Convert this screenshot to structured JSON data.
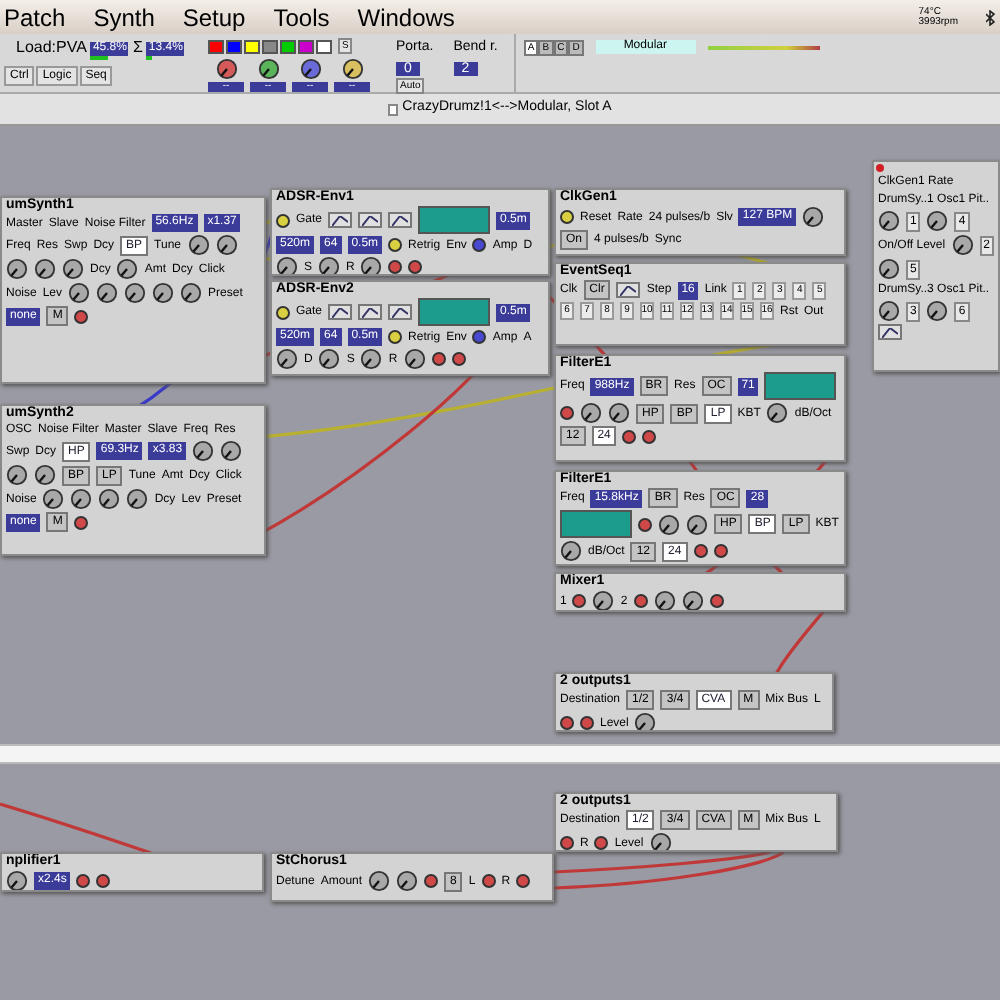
{
  "menu": [
    {
      "label": "Patch"
    },
    {
      "label": "Synth"
    },
    {
      "label": "Setup"
    },
    {
      "label": "Tools"
    },
    {
      "label": "Windows"
    }
  ],
  "status": {
    "temperature": "74°C",
    "fan": "3993rpm"
  },
  "load": {
    "label": "Load:PVA",
    "pva": {
      "value": "45.8%",
      "level": 0.45
    },
    "sigma": "Σ",
    "total": {
      "value": "13.4%",
      "level": 0.13
    }
  },
  "view_tabs": [
    {
      "label": "Ctrl"
    },
    {
      "label": "Logic"
    },
    {
      "label": "Seq"
    }
  ],
  "colors": [
    {
      "color": "#ff0000"
    },
    {
      "color": "#0000ff"
    },
    {
      "color": "#ffff00"
    },
    {
      "color": "#888888"
    },
    {
      "color": "#00cc00"
    },
    {
      "color": "#cc00cc"
    },
    {
      "color": "#ffffff"
    }
  ],
  "color_key": "S",
  "morph_knobs": [
    {
      "color": "#d45a5a",
      "value": "--"
    },
    {
      "color": "#5ab55a",
      "value": "--"
    },
    {
      "color": "#6a6ad8",
      "value": "--"
    },
    {
      "color": "#d8c060",
      "value": "--"
    }
  ],
  "porta": {
    "label": "Porta.",
    "value": "0",
    "auto": "Auto"
  },
  "bend": {
    "label": "Bend r.",
    "value": "2"
  },
  "slots": [
    {
      "label": "A",
      "selected": true
    },
    {
      "label": "B",
      "selected": false
    },
    {
      "label": "C",
      "selected": false
    },
    {
      "label": "D",
      "selected": false
    }
  ],
  "patch_name": "Modular",
  "title": "CrazyDrumz!1<-->Modular, Slot A",
  "modules": [
    {
      "title": "umSynth1",
      "items": [
        {
          "kind": "label",
          "text": "Master"
        },
        {
          "kind": "label",
          "text": "Slave"
        },
        {
          "kind": "label",
          "text": "Noise Filter"
        },
        {
          "kind": "display",
          "text": "56.6Hz"
        },
        {
          "kind": "display",
          "text": "x1.37"
        },
        {
          "kind": "label",
          "text": "Freq"
        },
        {
          "kind": "label",
          "text": "Res"
        },
        {
          "kind": "label",
          "text": "Swp"
        },
        {
          "kind": "label",
          "text": "Dcy"
        },
        {
          "kind": "button",
          "text": "BP",
          "selected": true
        },
        {
          "kind": "label",
          "text": "Tune"
        },
        {
          "kind": "knob"
        },
        {
          "kind": "knob"
        },
        {
          "kind": "knob"
        },
        {
          "kind": "knob"
        },
        {
          "kind": "knob"
        },
        {
          "kind": "label",
          "text": "Dcy"
        },
        {
          "kind": "knob"
        },
        {
          "kind": "label",
          "text": "Amt"
        },
        {
          "kind": "label",
          "text": "Dcy"
        },
        {
          "kind": "label",
          "text": "Click"
        },
        {
          "kind": "label",
          "text": "Noise"
        },
        {
          "kind": "label",
          "text": "Lev"
        },
        {
          "kind": "knob"
        },
        {
          "kind": "knob"
        },
        {
          "kind": "knob"
        },
        {
          "kind": "knob"
        },
        {
          "kind": "knob"
        },
        {
          "kind": "label",
          "text": "Preset"
        },
        {
          "kind": "display",
          "text": "none"
        },
        {
          "kind": "button",
          "text": "M",
          "selected": false
        },
        {
          "kind": "jack",
          "color": "#d04848"
        }
      ]
    },
    {
      "title": "umSynth2",
      "items": [
        {
          "kind": "label",
          "text": "OSC"
        },
        {
          "kind": "label",
          "text": "Noise Filter"
        },
        {
          "kind": "label",
          "text": "Master"
        },
        {
          "kind": "label",
          "text": "Slave"
        },
        {
          "kind": "label",
          "text": "Freq"
        },
        {
          "kind": "label",
          "text": "Res"
        },
        {
          "kind": "label",
          "text": "Swp"
        },
        {
          "kind": "label",
          "text": "Dcy"
        },
        {
          "kind": "button",
          "text": "HP",
          "selected": true
        },
        {
          "kind": "display",
          "text": "69.3Hz"
        },
        {
          "kind": "display",
          "text": "x3.83"
        },
        {
          "kind": "knob"
        },
        {
          "kind": "knob"
        },
        {
          "kind": "knob"
        },
        {
          "kind": "knob"
        },
        {
          "kind": "button",
          "text": "BP",
          "selected": false
        },
        {
          "kind": "button",
          "text": "LP",
          "selected": false
        },
        {
          "kind": "label",
          "text": "Tune"
        },
        {
          "kind": "label",
          "text": "Amt"
        },
        {
          "kind": "label",
          "text": "Dcy"
        },
        {
          "kind": "label",
          "text": "Click"
        },
        {
          "kind": "label",
          "text": "Noise"
        },
        {
          "kind": "knob"
        },
        {
          "kind": "knob"
        },
        {
          "kind": "knob"
        },
        {
          "kind": "knob"
        },
        {
          "kind": "label",
          "text": "Dcy"
        },
        {
          "kind": "label",
          "text": "Lev"
        },
        {
          "kind": "label",
          "text": "Preset"
        },
        {
          "kind": "display",
          "text": "none"
        },
        {
          "kind": "button",
          "text": "M",
          "selected": false
        },
        {
          "kind": "jack",
          "color": "#d04848"
        }
      ]
    },
    {
      "title": "ADSR-Env1",
      "items": [
        {
          "kind": "jack",
          "color": "#d8d040"
        },
        {
          "kind": "label",
          "text": "Gate"
        },
        {
          "kind": "icon_button"
        },
        {
          "kind": "icon_button"
        },
        {
          "kind": "icon_button"
        },
        {
          "kind": "screen"
        },
        {
          "kind": "display",
          "text": "0.5m"
        },
        {
          "kind": "display",
          "text": "520m"
        },
        {
          "kind": "display",
          "text": "64"
        },
        {
          "kind": "display",
          "text": "0.5m"
        },
        {
          "kind": "jack",
          "color": "#d8d040"
        },
        {
          "kind": "label",
          "text": "Retrig"
        },
        {
          "kind": "label",
          "text": "Env"
        },
        {
          "kind": "jack",
          "color": "#4848d0"
        },
        {
          "kind": "label",
          "text": "Amp"
        },
        {
          "kind": "label",
          "text": "D"
        },
        {
          "kind": "knob"
        },
        {
          "kind": "label",
          "text": "S"
        },
        {
          "kind": "knob"
        },
        {
          "kind": "label",
          "text": "R"
        },
        {
          "kind": "knob"
        },
        {
          "kind": "jack",
          "color": "#d04848"
        },
        {
          "kind": "jack",
          "color": "#d04848"
        }
      ]
    },
    {
      "title": "ADSR-Env2",
      "items": [
        {
          "kind": "jack",
          "color": "#d8d040"
        },
        {
          "kind": "label",
          "text": "Gate"
        },
        {
          "kind": "icon_button"
        },
        {
          "kind": "icon_button"
        },
        {
          "kind": "icon_button"
        },
        {
          "kind": "screen"
        },
        {
          "kind": "display",
          "text": "0.5m"
        },
        {
          "kind": "display",
          "text": "520m"
        },
        {
          "kind": "display",
          "text": "64"
        },
        {
          "kind": "display",
          "text": "0.5m"
        },
        {
          "kind": "jack",
          "color": "#d8d040"
        },
        {
          "kind": "label",
          "text": "Retrig"
        },
        {
          "kind": "label",
          "text": "Env"
        },
        {
          "kind": "jack",
          "color": "#4848d0"
        },
        {
          "kind": "label",
          "text": "Amp"
        },
        {
          "kind": "label",
          "text": "A"
        },
        {
          "kind": "knob"
        },
        {
          "kind": "label",
          "text": "D"
        },
        {
          "kind": "knob"
        },
        {
          "kind": "label",
          "text": "S"
        },
        {
          "kind": "knob"
        },
        {
          "kind": "label",
          "text": "R"
        },
        {
          "kind": "knob"
        },
        {
          "kind": "jack",
          "color": "#d04848"
        },
        {
          "kind": "jack",
          "color": "#d04848"
        }
      ]
    },
    {
      "title": "ClkGen1",
      "items": [
        {
          "kind": "jack",
          "color": "#d8d040"
        },
        {
          "kind": "label",
          "text": "Reset"
        },
        {
          "kind": "label",
          "text": "Rate"
        },
        {
          "kind": "label",
          "text": "24 pulses/b"
        },
        {
          "kind": "label",
          "text": "Slv"
        },
        {
          "kind": "display",
          "text": "127 BPM"
        },
        {
          "kind": "knob"
        },
        {
          "kind": "button",
          "text": "On",
          "selected": false
        },
        {
          "kind": "label",
          "text": "4 pulses/b"
        },
        {
          "kind": "label",
          "text": "Sync"
        }
      ]
    },
    {
      "title": "EventSeq1",
      "items": [
        {
          "kind": "label",
          "text": "Clk"
        },
        {
          "kind": "button",
          "text": "Clr",
          "selected": false
        },
        {
          "kind": "icon_button"
        },
        {
          "kind": "label",
          "text": "Step"
        },
        {
          "kind": "display",
          "text": "16"
        },
        {
          "kind": "label",
          "text": "Link"
        },
        {
          "kind": "step",
          "text": "1"
        },
        {
          "kind": "step",
          "text": "2"
        },
        {
          "kind": "step",
          "text": "3"
        },
        {
          "kind": "step",
          "text": "4"
        },
        {
          "kind": "step",
          "text": "5"
        },
        {
          "kind": "step",
          "text": "6"
        },
        {
          "kind": "step",
          "text": "7"
        },
        {
          "kind": "step",
          "text": "8"
        },
        {
          "kind": "step",
          "text": "9"
        },
        {
          "kind": "step",
          "text": "10"
        },
        {
          "kind": "step",
          "text": "11"
        },
        {
          "kind": "step",
          "text": "12"
        },
        {
          "kind": "step",
          "text": "13"
        },
        {
          "kind": "step",
          "text": "14"
        },
        {
          "kind": "step",
          "text": "15"
        },
        {
          "kind": "step",
          "text": "16"
        },
        {
          "kind": "label",
          "text": "Rst"
        },
        {
          "kind": "label",
          "text": "Out"
        }
      ]
    },
    {
      "title": "FilterE1",
      "items": [
        {
          "kind": "label",
          "text": "Freq"
        },
        {
          "kind": "display",
          "text": "988Hz"
        },
        {
          "kind": "button",
          "text": "BR",
          "selected": false
        },
        {
          "kind": "label",
          "text": "Res"
        },
        {
          "kind": "button",
          "text": "OC",
          "selected": false
        },
        {
          "kind": "display",
          "text": "71"
        },
        {
          "kind": "screen"
        },
        {
          "kind": "jack",
          "color": "#d04848"
        },
        {
          "kind": "knob"
        },
        {
          "kind": "knob"
        },
        {
          "kind": "button",
          "text": "HP",
          "selected": false
        },
        {
          "kind": "button",
          "text": "BP",
          "selected": false
        },
        {
          "kind": "button",
          "text": "LP",
          "selected": true
        },
        {
          "kind": "label",
          "text": "KBT"
        },
        {
          "kind": "knob"
        },
        {
          "kind": "label",
          "text": "dB/Oct"
        },
        {
          "kind": "button",
          "text": "12",
          "selected": false
        },
        {
          "kind": "button",
          "text": "24",
          "selected": true
        },
        {
          "kind": "jack",
          "color": "#d04848"
        },
        {
          "kind": "jack",
          "color": "#d04848"
        }
      ]
    },
    {
      "title": "FilterE1",
      "items": [
        {
          "kind": "label",
          "text": "Freq"
        },
        {
          "kind": "display",
          "text": "15.8kHz"
        },
        {
          "kind": "button",
          "text": "BR",
          "selected": false
        },
        {
          "kind": "label",
          "text": "Res"
        },
        {
          "kind": "button",
          "text": "OC",
          "selected": false
        },
        {
          "kind": "display",
          "text": "28"
        },
        {
          "kind": "screen"
        },
        {
          "kind": "jack",
          "color": "#d04848"
        },
        {
          "kind": "knob"
        },
        {
          "kind": "knob"
        },
        {
          "kind": "button",
          "text": "HP",
          "selected": false
        },
        {
          "kind": "button",
          "text": "BP",
          "selected": true
        },
        {
          "kind": "button",
          "text": "LP",
          "selected": false
        },
        {
          "kind": "label",
          "text": "KBT"
        },
        {
          "kind": "knob"
        },
        {
          "kind": "label",
          "text": "dB/Oct"
        },
        {
          "kind": "button",
          "text": "12",
          "selected": false
        },
        {
          "kind": "button",
          "text": "24",
          "selected": true
        },
        {
          "kind": "jack",
          "color": "#d04848"
        },
        {
          "kind": "jack",
          "color": "#d04848"
        }
      ]
    },
    {
      "title": "Mixer1",
      "items": [
        {
          "kind": "label",
          "text": "1"
        },
        {
          "kind": "jack",
          "color": "#d04848"
        },
        {
          "kind": "knob"
        },
        {
          "kind": "label",
          "text": "2"
        },
        {
          "kind": "jack",
          "color": "#d04848"
        },
        {
          "kind": "knob"
        },
        {
          "kind": "knob"
        },
        {
          "kind": "jack",
          "color": "#d04848"
        }
      ]
    },
    {
      "title": "2 outputs1",
      "items": [
        {
          "kind": "label",
          "text": "Destination"
        },
        {
          "kind": "button",
          "text": "1/2",
          "selected": false
        },
        {
          "kind": "button",
          "text": "3/4",
          "selected": false
        },
        {
          "kind": "button",
          "text": "CVA",
          "selected": true
        },
        {
          "kind": "button",
          "text": "M",
          "selected": false
        },
        {
          "kind": "label",
          "text": "Mix Bus"
        },
        {
          "kind": "label",
          "text": "L"
        },
        {
          "kind": "jack",
          "color": "#d04848"
        },
        {
          "kind": "jack",
          "color": "#d04848"
        },
        {
          "kind": "label",
          "text": "Level"
        },
        {
          "kind": "knob"
        }
      ]
    },
    {
      "items": [
        {
          "kind": "label",
          "text": "ClkGen1 Rate"
        },
        {
          "kind": "label",
          "text": "DrumSy..1 Osc1 Pit.."
        },
        {
          "kind": "knob"
        },
        {
          "kind": "led",
          "text": "1"
        },
        {
          "kind": "knob"
        },
        {
          "kind": "led",
          "text": "4"
        },
        {
          "kind": "label",
          "text": "On/Off Level"
        },
        {
          "kind": "knob"
        },
        {
          "kind": "led",
          "text": "2"
        },
        {
          "kind": "knob"
        },
        {
          "kind": "led",
          "text": "5"
        },
        {
          "kind": "label",
          "text": "DrumSy..3 Osc1 Pit.."
        },
        {
          "kind": "knob"
        },
        {
          "kind": "led",
          "text": "3"
        },
        {
          "kind": "knob"
        },
        {
          "kind": "led",
          "text": "6"
        },
        {
          "kind": "icon_button"
        }
      ]
    },
    {
      "title": "nplifier1",
      "items": [
        {
          "kind": "knob"
        },
        {
          "kind": "display",
          "text": "x2.4s"
        },
        {
          "kind": "jack",
          "color": "#d04848"
        },
        {
          "kind": "jack",
          "color": "#d04848"
        }
      ]
    },
    {
      "title": "StChorus1",
      "items": [
        {
          "kind": "label",
          "text": "Detune"
        },
        {
          "kind": "label",
          "text": "Amount"
        },
        {
          "kind": "knob"
        },
        {
          "kind": "knob"
        },
        {
          "kind": "jack",
          "color": "#d04848"
        },
        {
          "kind": "button",
          "text": "8",
          "selected": false
        },
        {
          "kind": "label",
          "text": "L"
        },
        {
          "kind": "jack",
          "color": "#d04848"
        },
        {
          "kind": "label",
          "text": "R"
        },
        {
          "kind": "jack",
          "color": "#d04848"
        }
      ]
    },
    {
      "title": "2 outputs1",
      "items": [
        {
          "kind": "label",
          "text": "Destination"
        },
        {
          "kind": "button",
          "text": "1/2",
          "selected": true
        },
        {
          "kind": "button",
          "text": "3/4",
          "selected": false
        },
        {
          "kind": "button",
          "text": "CVA",
          "selected": false
        },
        {
          "kind": "button",
          "text": "M",
          "selected": false
        },
        {
          "kind": "label",
          "text": "Mix Bus"
        },
        {
          "kind": "label",
          "text": "L"
        },
        {
          "kind": "jack",
          "color": "#d04848"
        },
        {
          "kind": "label",
          "text": "R"
        },
        {
          "kind": "jack",
          "color": "#d04848"
        },
        {
          "kind": "label",
          "text": "Level"
        },
        {
          "kind": "knob"
        }
      ]
    }
  ]
}
